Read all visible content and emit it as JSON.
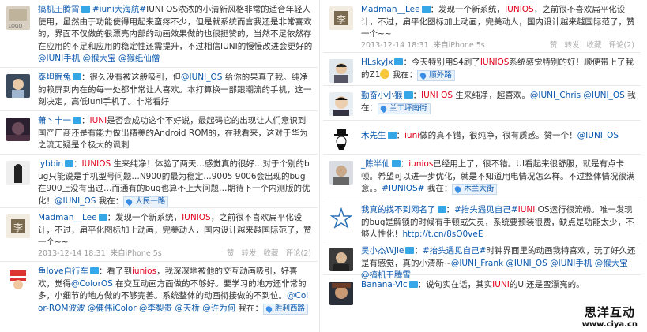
{
  "left": [
    {
      "author": "搞机王腾霄",
      "segments": [
        {
          "t": " ",
          "k": "plain"
        },
        {
          "t": "#iuni大海航#",
          "k": "tag"
        },
        {
          "t": "IUNI OS浓浓的小清新风格非常的适合年轻人使用，虽然由于功能使得用起来蛮疼不少，但是就系统而言我还是非常喜欢的，界面不仅做的很漂亮内部的动画效果做的也很挺赞的，当然不足依然存在应用的不足和应用的稳定性还需提升，不过相信IUNI的慢慢改进会更好的",
          "k": "plain"
        },
        {
          "t": "@IUNI手机",
          "k": "mention"
        },
        {
          "t": " ",
          "k": "plain"
        },
        {
          "t": "@猴大宝",
          "k": "mention"
        },
        {
          "t": " ",
          "k": "plain"
        },
        {
          "t": "@猴纸仙僧",
          "k": "mention"
        }
      ]
    },
    {
      "author": "泰坦眠兔",
      "segments": [
        {
          "t": "：很久没有被这般吸引，但",
          "k": "plain"
        },
        {
          "t": "@IUNI_OS",
          "k": "mention"
        },
        {
          "t": " 给你的果真了我。纯净的赖屏到内在的每一处都非常让人喜欢。本打算换一部跟潮流的手机，这一刻决定，高低iuni手机了。非常看好",
          "k": "plain"
        }
      ]
    },
    {
      "author": "萧丶十一",
      "segments": [
        {
          "t": "：",
          "k": "plain"
        },
        {
          "t": "IUNI",
          "k": "kw"
        },
        {
          "t": "是否会成功这个不好说，最起码它的出现让人们意识到国产厂商还是有能力做出精美的Android ROM的，在我看来，这对于华为之流无疑是个极大的讽刺",
          "k": "plain"
        }
      ]
    },
    {
      "author": "lybbin",
      "segments": [
        {
          "t": "：",
          "k": "plain"
        },
        {
          "t": "IUNIOS",
          "k": "kw"
        },
        {
          "t": " 生来纯净！体验了两天…感觉真的很好…对于个别的bug只能说是手机型号问题…N900的最为稳定…9005 9006会出现的bug在900上没有出过…而通有的bug也算不上大问题…期待下一个内测版的优化！",
          "k": "plain"
        },
        {
          "t": "@IUNI_OS",
          "k": "mention"
        },
        {
          "t": " 我在：",
          "k": "plain"
        }
      ],
      "loc": "人民一路"
    },
    {
      "author": "Madman__Lee",
      "segments": [
        {
          "t": "：发现一个新系统，",
          "k": "plain"
        },
        {
          "t": "IUNIOS",
          "k": "kw"
        },
        {
          "t": "，之前很不喜欢扁平化设计，不过，扁平化图标加上动画，完美动人，国内设计越来越国际范了，赞一个~~",
          "k": "plain"
        }
      ],
      "time": "2013-12-14 18:31",
      "source": "来自iPhone 5s",
      "actions": [
        "赞",
        "转发",
        "收藏",
        "评论(2)"
      ]
    },
    {
      "author": "鱼love自行车",
      "segments": [
        {
          "t": "：看了到",
          "k": "plain"
        },
        {
          "t": "iunios",
          "k": "kw"
        },
        {
          "t": "，我深深地被他的交互动画吸引，好喜欢，觉得",
          "k": "plain"
        },
        {
          "t": "@ColorOS",
          "k": "mention"
        },
        {
          "t": " 在交互动画方面做的不够好。要学习的地方还非常的多，小细节的地方做的不够完善。系统整体的动画衔接做的不到位。",
          "k": "plain"
        },
        {
          "t": "@Color-ROM波波",
          "k": "mention"
        },
        {
          "t": " ",
          "k": "plain"
        },
        {
          "t": "@健伟iColor",
          "k": "mention"
        },
        {
          "t": " ",
          "k": "plain"
        },
        {
          "t": "@李梨贵",
          "k": "mention"
        },
        {
          "t": " ",
          "k": "plain"
        },
        {
          "t": "@天桥",
          "k": "mention"
        },
        {
          "t": " ",
          "k": "plain"
        },
        {
          "t": "@许为何",
          "k": "mention"
        },
        {
          "t": " 我在：",
          "k": "plain"
        }
      ],
      "loc": "胜利西路"
    }
  ],
  "right": [
    {
      "author": "Madman__Lee",
      "segments": [
        {
          "t": "：发现一个新系统，",
          "k": "plain"
        },
        {
          "t": "IUNIOS",
          "k": "kw"
        },
        {
          "t": "，之前很不喜欢扁平化设计，不过，扁平化图标加上动画，完美动人，国内设计越来越国际范了，赞一个~~",
          "k": "plain"
        }
      ],
      "time": "2013-12-14 18:31",
      "source": "来自iPhone 5s",
      "actions": [
        "赞",
        "转发",
        "收藏",
        "评论(2)"
      ]
    },
    {
      "author": "HLskyJx",
      "segments": [
        {
          "t": "：今天特别用S4刷了",
          "k": "plain"
        },
        {
          "t": "IUNIOS",
          "k": "kw"
        },
        {
          "t": "系统感觉特别的好！顺便带上了我的Z1",
          "k": "plain"
        },
        {
          "t": "",
          "k": "emoji"
        },
        {
          "t": " 我在：",
          "k": "plain"
        }
      ],
      "loc": "顺外路"
    },
    {
      "author": "勤奋小小猴",
      "segments": [
        {
          "t": "：",
          "k": "plain"
        },
        {
          "t": "IUNI OS",
          "k": "kw"
        },
        {
          "t": " 生来纯净，超喜欢。",
          "k": "plain"
        },
        {
          "t": "@IUNI_Chris",
          "k": "mention"
        },
        {
          "t": " ",
          "k": "plain"
        },
        {
          "t": "@IUNI_OS",
          "k": "mention"
        },
        {
          "t": " 我在：",
          "k": "plain"
        }
      ],
      "loc": "兰工坪南街"
    },
    {
      "author": "木先生",
      "segments": [
        {
          "t": "：",
          "k": "plain"
        },
        {
          "t": "iuni",
          "k": "kw"
        },
        {
          "t": "做的真不错，很纯净，很有质感。赞一个！",
          "k": "plain"
        },
        {
          "t": "@IUNI_OS",
          "k": "mention"
        }
      ]
    },
    {
      "author": "_陈半仙",
      "segments": [
        {
          "t": "：",
          "k": "plain"
        },
        {
          "t": "iunios",
          "k": "kw"
        },
        {
          "t": "已经用上了，很不错。UI看起来很舒服，就是有点卡顿。希望可以进一步优化，就是不知道用电情况怎么样。不过整体情况很满意。。",
          "k": "plain"
        },
        {
          "t": "#IUNIOS#",
          "k": "tag"
        },
        {
          "t": " 我在：",
          "k": "plain"
        }
      ],
      "loc": "木兰大街"
    },
    {
      "author": "我真的找不到网名了",
      "segments": [
        {
          "t": "：",
          "k": "plain"
        },
        {
          "t": "#抬头遇见自己#",
          "k": "tag"
        },
        {
          "t": "IUNI",
          "k": "kw"
        },
        {
          "t": " OS运行很流畅。唯一发现的bug是解锁的时候有手顿或失灵，系统要预装很费，缺点是功能太少，不够人性化！",
          "k": "plain"
        },
        {
          "t": "http://t.cn/8sO0veE",
          "k": "mention"
        }
      ]
    },
    {
      "author": "吴小杰WJie",
      "segments": [
        {
          "t": "：",
          "k": "plain"
        },
        {
          "t": "#抬头遇见自己#",
          "k": "tag"
        },
        {
          "t": "时钟界面里的动画我特喜欢，玩了好久还是有感觉，真的小清新~",
          "k": "plain"
        },
        {
          "t": "@IUNI_Frank",
          "k": "mention"
        },
        {
          "t": " ",
          "k": "plain"
        },
        {
          "t": "@IUNI_OS",
          "k": "mention"
        },
        {
          "t": " ",
          "k": "plain"
        },
        {
          "t": "@IUNI手机",
          "k": "mention"
        },
        {
          "t": " ",
          "k": "plain"
        },
        {
          "t": "@猴大宝",
          "k": "mention"
        },
        {
          "t": " ",
          "k": "plain"
        },
        {
          "t": "@搞机王腾霄",
          "k": "mention"
        }
      ]
    },
    {
      "author": "Banana-Vic",
      "segments": [
        {
          "t": "：说句实在话，其实",
          "k": "plain"
        },
        {
          "t": "IUNI",
          "k": "kw"
        },
        {
          "t": "的UI还是蛮漂亮的。",
          "k": "plain"
        }
      ]
    }
  ],
  "watermark": {
    "main": "思洋互动",
    "url": "www.ciya.cn"
  },
  "colors": {
    "link": "#0a58ad",
    "keyword": "#e1001c",
    "text": "#333333",
    "meta": "#999999"
  }
}
